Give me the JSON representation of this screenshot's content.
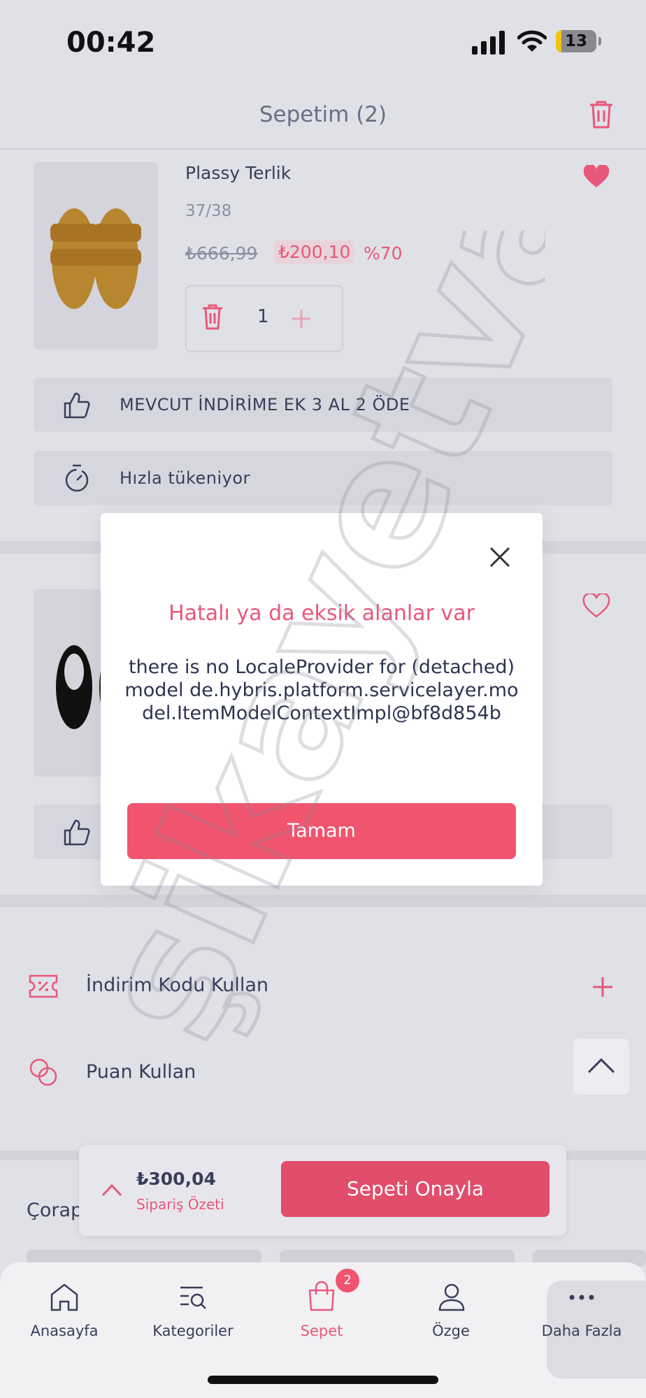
{
  "status_bar": {
    "time": "00:42",
    "battery": "13",
    "battery_level": 0.13
  },
  "header": {
    "title": "Sepetim (2)",
    "trash_icon": "trash-icon"
  },
  "product1": {
    "name": "Plassy Terlik",
    "variant": "37/38",
    "old_price": "₺666,99",
    "new_price": "₺200,10",
    "discount": "%70",
    "quantity": "1"
  },
  "promos": [
    {
      "icon": "thumbs-up-icon",
      "text": "MEVCUT İNDİRİME EK 3 AL 2 ÖDE"
    },
    {
      "icon": "stopwatch-icon",
      "text": "Hızla tükeniyor"
    }
  ],
  "list_rows": [
    {
      "icon": "coupon-icon",
      "label": "İndirim Kodu Kullan"
    },
    {
      "icon": "points-icon",
      "label": "Puan Kullan"
    }
  ],
  "related_title": "Çorap",
  "summary": {
    "total": "₺300,04",
    "label": "Sipariş Özeti",
    "confirm": "Sepeti Onayla"
  },
  "tabs": [
    {
      "label": "Anasayfa",
      "icon": "home-icon"
    },
    {
      "label": "Kategoriler",
      "icon": "categories-icon"
    },
    {
      "label": "Sepet",
      "icon": "bag-icon",
      "badge": "2"
    },
    {
      "label": "Özge",
      "icon": "profile-icon"
    },
    {
      "label": "Daha Fazla",
      "icon": "more-icon"
    }
  ],
  "modal": {
    "title": "Hatalı ya da eksik alanlar var",
    "message": "there is no LocaleProvider for (detached) model de.hybris.platform.servicelayer.model.ItemModelContextImpl@bf8d854b",
    "ok": "Tamam"
  },
  "watermark": "şikayetvar",
  "colors": {
    "accent": "#e8587a",
    "button": "#f0546f",
    "text": "#2f3352"
  }
}
